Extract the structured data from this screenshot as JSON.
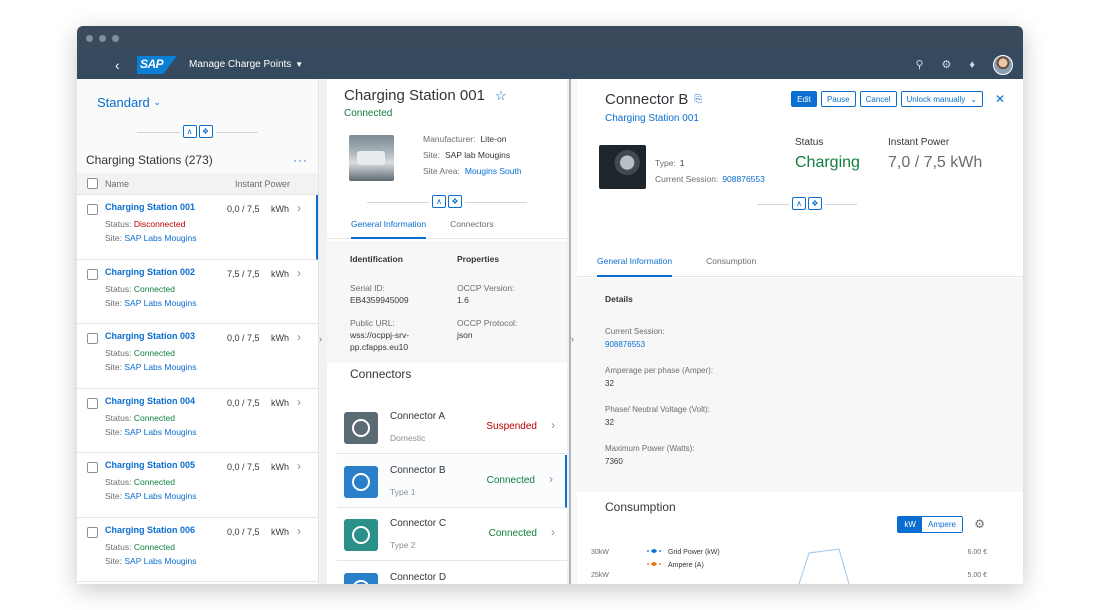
{
  "window": {
    "app_title": "Manage Charge Points",
    "logo": "SAP"
  },
  "shell": {
    "icons": [
      "search-icon",
      "settings-icon",
      "bell-icon"
    ]
  },
  "master": {
    "variant": "Standard",
    "list_title": "Charging Stations (273)",
    "more": "···",
    "columns": {
      "name": "Name",
      "power": "Instant Power"
    },
    "rows": [
      {
        "name": "Charging Station 001",
        "status_label": "Status:",
        "status": "Disconnected",
        "status_color": "#bb0000",
        "site_label": "Site:",
        "site": "SAP Labs Mougins",
        "power": "0,0 / 7,5",
        "unit": "kWh",
        "selected": true
      },
      {
        "name": "Charging Station 002",
        "status_label": "Status:",
        "status": "Connected",
        "status_color": "#107e3e",
        "site_label": "Site:",
        "site": "SAP Labs Mougins",
        "power": "7,5 / 7,5",
        "unit": "kWh",
        "selected": false
      },
      {
        "name": "Charging Station 003",
        "status_label": "Status:",
        "status": "Connected",
        "status_color": "#107e3e",
        "site_label": "Site:",
        "site": "SAP Labs Mougins",
        "power": "0,0 / 7,5",
        "unit": "kWh",
        "selected": false
      },
      {
        "name": "Charging Station 004",
        "status_label": "Status:",
        "status": "Connected",
        "status_color": "#107e3e",
        "site_label": "Site:",
        "site": "SAP Labs Mougins",
        "power": "0,0 / 7,5",
        "unit": "kWh",
        "selected": false
      },
      {
        "name": "Charging Station 005",
        "status_label": "Status:",
        "status": "Connected",
        "status_color": "#107e3e",
        "site_label": "Site:",
        "site": "SAP Labs Mougins",
        "power": "0,0 / 7,5",
        "unit": "kWh",
        "selected": false
      },
      {
        "name": "Charging Station 006",
        "status_label": "Status:",
        "status": "Connected",
        "status_color": "#107e3e",
        "site_label": "Site:",
        "site": "SAP Labs Mougins",
        "power": "0,0 / 7,5",
        "unit": "kWh",
        "selected": false
      }
    ]
  },
  "station": {
    "title": "Charging Station 001",
    "status": "Connected",
    "manufacturer_label": "Manufacturer:",
    "manufacturer": "Lite-on",
    "site_label": "Site:",
    "site": "SAP lab Mougins",
    "area_label": "Site Area:",
    "area": "Mougins South",
    "tabs": [
      "General Information",
      "Connectors"
    ],
    "identification": {
      "heading": "Identification",
      "serial_label": "Serial ID:",
      "serial": "EB4359945009",
      "url_label": "Public URL:",
      "url_1": "wss://ocppj-srv-",
      "url_2": "pp.cfapps.eu10"
    },
    "properties": {
      "heading": "Properties",
      "ocpp_version_label": "OCCP Version:",
      "ocpp_version": "1.6",
      "ocpp_protocol_label": "OCCP Protocol:",
      "ocpp_protocol": "json"
    },
    "connectors_title": "Connectors",
    "connectors": [
      {
        "name": "Connector A",
        "type": "Domestic",
        "status": "Suspended",
        "status_color": "#bb0000",
        "icon_color": "#5b6b74"
      },
      {
        "name": "Connector B",
        "type": "Type 1",
        "status": "Connected",
        "status_color": "#107e3e",
        "icon_color": "#2a7fc9"
      },
      {
        "name": "Connector C",
        "type": "Type 2",
        "status": "Connected",
        "status_color": "#107e3e",
        "icon_color": "#2b8f8a"
      },
      {
        "name": "Connector D",
        "type": "",
        "status": "",
        "status_color": "#107e3e",
        "icon_color": "#2a7fc9"
      }
    ]
  },
  "detail": {
    "title": "Connector B",
    "parent": "Charging Station 001",
    "actions": {
      "edit": "Edit",
      "pause": "Pause",
      "cancel": "Cancel",
      "unlock": "Unlock manually"
    },
    "type_label": "Type:",
    "type": "1",
    "session_label": "Current Session:",
    "session": "908876553",
    "status_label": "Status",
    "status": "Charging",
    "power_label": "Instant Power",
    "power": "7,0 / 7,5 kWh",
    "tabs": [
      "General Information",
      "Consumption"
    ],
    "details_heading": "Details",
    "fields": [
      {
        "label": "Current Session:",
        "value": "908876553",
        "link": true
      },
      {
        "label": "Amperage per phase (Amper):",
        "value": "32",
        "link": false
      },
      {
        "label": "Phase/ Neutral Voltage (Volt):",
        "value": "32",
        "link": false
      },
      {
        "label": "Maximum Power (Watts):",
        "value": "7360",
        "link": false
      }
    ],
    "consumption_title": "Consumption",
    "toggle": {
      "kw": "kW",
      "ampere": "Ampere"
    }
  },
  "chart_data": {
    "type": "line",
    "title": "",
    "y_left_ticks": [
      "30kW",
      "25kW"
    ],
    "y_right_ticks": [
      "6.00 €",
      "5.00 €"
    ],
    "series": [
      {
        "name": "Grid Power (kW)",
        "color": "#0a6ed1"
      },
      {
        "name": "Ampere (A)",
        "color": "#e9730c"
      }
    ]
  }
}
